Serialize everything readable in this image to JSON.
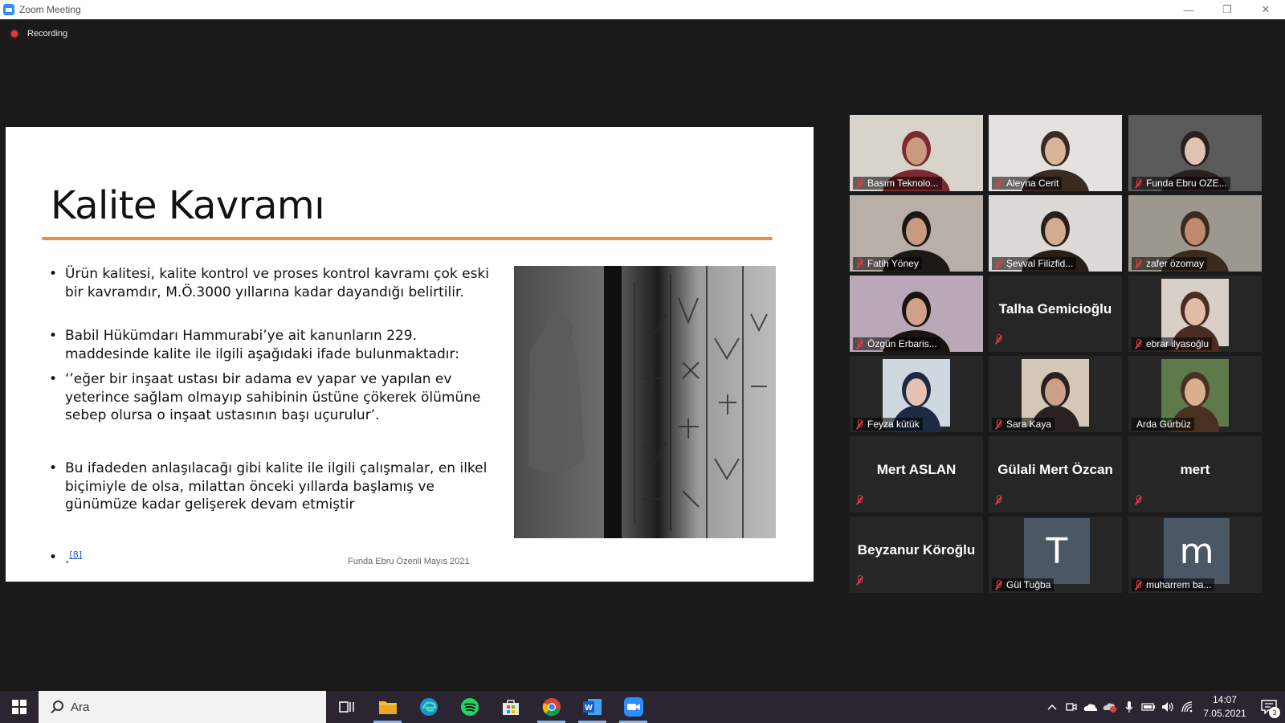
{
  "window": {
    "title": "Zoom Meeting"
  },
  "recording": {
    "label": "Recording"
  },
  "slide": {
    "title": "Kalite Kavramı",
    "bullets": [
      "Ürün kalitesi, kalite kontrol ve proses kontrol kavramı çok eski bir kavramdır, M.Ö.3000 yıllarına kadar dayandığı belirtilir.",
      "Babil Hükümdarı Hammurabi’ye ait kanunların 229. maddesinde kalite ile ilgili aşağıdaki ifade bulunmaktadır:",
      "‘’eğer bir inşaat ustası bir adama ev yapar ve yapılan ev yeterince sağlam olmayıp sahibinin üstüne çökerek ölümüne sebep olursa o inşaat ustasının başı uçurulur’.",
      "Bu ifadeden anlaşılacağı gibi kalite ile ilgili çalışmalar, en ilkel biçimiyle de olsa, milattan önceki yıllarda başlamış ve günümüze kadar gelişerek devam etmiştir"
    ],
    "ref_dot": ".",
    "ref_link": "[8]",
    "footer": "Funda Ebru Özenli Mayıs 2021"
  },
  "participants": [
    {
      "name": "Basım Teknolo...",
      "type": "video",
      "bg": "#d8d4cc",
      "skin": "#c99a80",
      "hair": "#7a2a30"
    },
    {
      "name": "Aleyna Cerit",
      "type": "video",
      "bg": "#e4e2de",
      "skin": "#d9b39a",
      "hair": "#3a2a22"
    },
    {
      "name": "Funda Ebru OZE...",
      "type": "video",
      "bg": "#5a5a5a",
      "skin": "#e0c2b0",
      "hair": "#2b2020",
      "active": true
    },
    {
      "name": "Fatih Yöney",
      "type": "video",
      "bg": "#b8b0a8",
      "skin": "#c89a80",
      "hair": "#1e1814"
    },
    {
      "name": "Şevval Filizfid...",
      "type": "video",
      "bg": "#dcdad6",
      "skin": "#d4ab92",
      "hair": "#2a1e18"
    },
    {
      "name": "zafer özomay",
      "type": "video",
      "bg": "#9c9890",
      "skin": "#c08a6e",
      "hair": "#3a2a20"
    },
    {
      "name": "Özgün Erbaris...",
      "type": "video",
      "bg": "#b8a8b8",
      "skin": "#d0a088",
      "hair": "#1a1410"
    },
    {
      "name": "Talha Gemicioğlu",
      "type": "name"
    },
    {
      "name": "ebrar ilyasoğlu",
      "type": "avatar",
      "bg": "#d8cfc8",
      "skin": "#e2bca4",
      "hair": "#4a2c22"
    },
    {
      "name": "Feyza kütük",
      "type": "avatar",
      "bg": "#cfd7e0",
      "skin": "#e4c4b0",
      "hair": "#1e2a44"
    },
    {
      "name": "Sara Kaya",
      "type": "avatar",
      "bg": "#d6c8b8",
      "skin": "#caa08a",
      "hair": "#2a2220"
    },
    {
      "name": "Arda Gürbüz",
      "type": "avatar",
      "bg": "#5e7a4a",
      "skin": "#d8b090",
      "hair": "#4a3020",
      "nomic": true
    },
    {
      "name": "Mert ASLAN",
      "type": "name"
    },
    {
      "name": "Gülali Mert Özcan",
      "type": "name"
    },
    {
      "name": "mert",
      "type": "name"
    },
    {
      "name": "Beyzanur Köroğlu",
      "type": "name"
    },
    {
      "name": "Gül Tuğba",
      "type": "letter",
      "letter": "T"
    },
    {
      "name": "muharrem ba...",
      "type": "letter",
      "letter": "m"
    }
  ],
  "taskbar": {
    "search_placeholder": "Ara",
    "time": "14:07",
    "date": "7.05.2021",
    "notification_count": "3"
  }
}
